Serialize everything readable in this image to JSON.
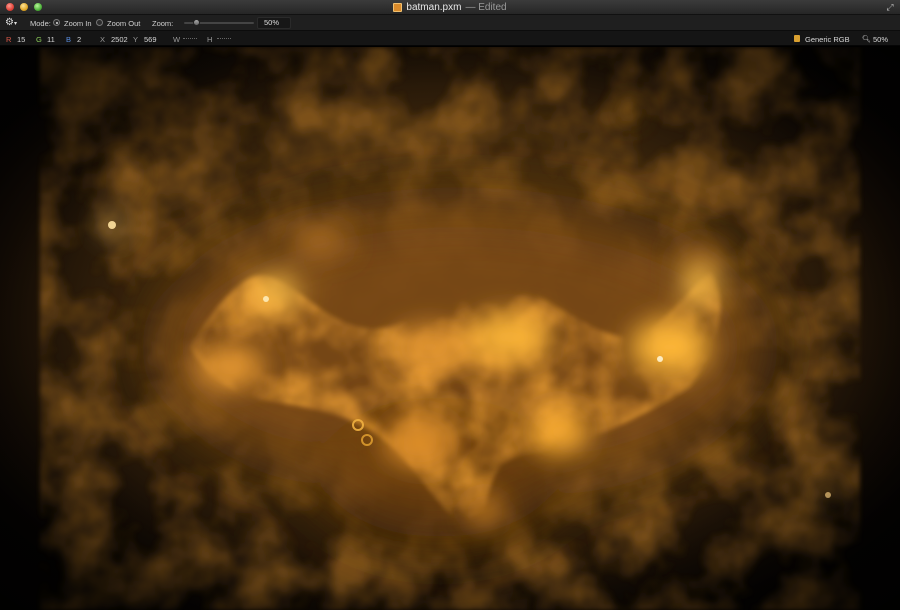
{
  "window": {
    "filename": "batman.pxm",
    "status": "— Edited"
  },
  "toolbar": {
    "mode_label": "Mode:",
    "zoom_in_label": "Zoom In",
    "zoom_out_label": "Zoom Out",
    "zoom_label": "Zoom:",
    "zoom_value": "50%",
    "selected_mode": "Zoom In",
    "slider_fraction": 0.15
  },
  "info": {
    "r_label": "R",
    "r_value": "15",
    "g_label": "G",
    "g_value": "11",
    "b_label": "B",
    "b_value": "2",
    "x_label": "X",
    "x_value": "2502",
    "y_label": "Y",
    "y_value": "569",
    "w_label": "W",
    "h_label": "H",
    "color_profile": "Generic RGB",
    "zoom_readout": "50%"
  },
  "icons": {
    "gear": "gear-icon",
    "document": "document-icon",
    "fullscreen": "fullscreen-icon",
    "profile": "color-profile-icon",
    "zoom": "magnifier-icon"
  },
  "colors": {
    "accent_orange": "#f0a030",
    "glow_yellow": "#ffd060",
    "canvas_dark": "#0a0705"
  }
}
